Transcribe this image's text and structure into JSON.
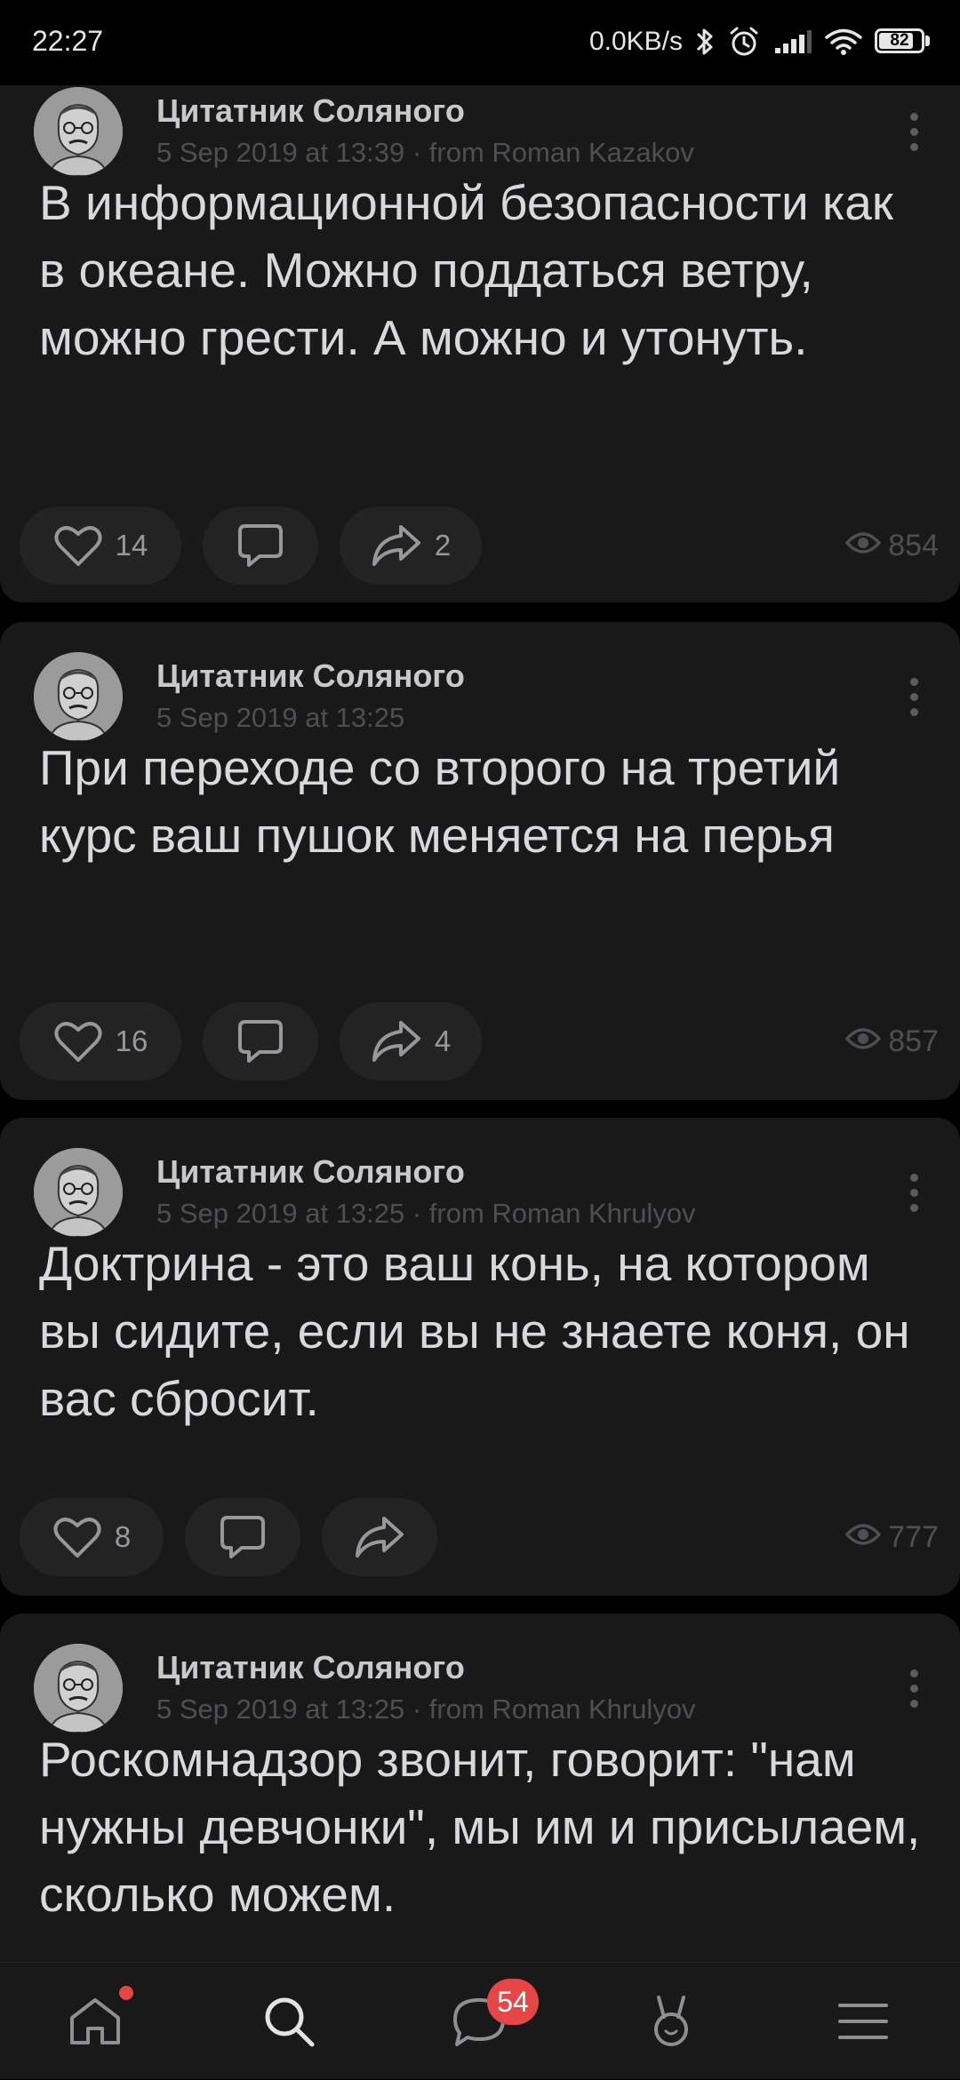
{
  "status_bar": {
    "time": "22:27",
    "network_speed": "0.0KB/s",
    "battery_level": "82",
    "battery_fraction": 0.82,
    "icons": [
      "bluetooth-icon",
      "alarm-icon",
      "signal-icon",
      "wifi-icon",
      "battery-icon"
    ]
  },
  "posts": [
    {
      "author": "Цитатник Соляного",
      "meta": "5 Sep 2019 at 13:39 · from Roman Kazakov",
      "text": "В информационной безопасности как в океане. Можно поддаться ветру, можно грести. А можно и утонуть.",
      "likes": "14",
      "comments": "",
      "shares": "2",
      "views": "854"
    },
    {
      "author": "Цитатник Соляного",
      "meta": "5 Sep 2019 at 13:25",
      "text": "При переходе со второго на третий курс ваш пушок меняется на перья",
      "likes": "16",
      "comments": "",
      "shares": "4",
      "views": "857"
    },
    {
      "author": "Цитатник Соляного",
      "meta": "5 Sep 2019 at 13:25 · from Roman Khrulyov",
      "text": "Доктрина - это ваш конь, на котором вы сидите, если вы не знаете коня, он вас сбросит.",
      "likes": "8",
      "comments": "",
      "shares": "",
      "views": "777"
    },
    {
      "author": "Цитатник Соляного",
      "meta": "5 Sep 2019 at 13:25 · from Roman Khrulyov",
      "text": "Роскомнадзор звонит, говорит: \"нам нужны девчонки\", мы им и присылаем, сколько можем.",
      "likes": "",
      "comments": "",
      "shares": "",
      "views": ""
    }
  ],
  "bottom_nav": {
    "items": [
      "home-icon",
      "search-icon",
      "messages-icon",
      "clips-icon",
      "menu-icon"
    ],
    "messages_badge": "54",
    "home_has_notification_dot": true
  },
  "colors": {
    "background": "#000000",
    "card": "#191919",
    "pill": "#232324",
    "badge": "#e64646"
  }
}
